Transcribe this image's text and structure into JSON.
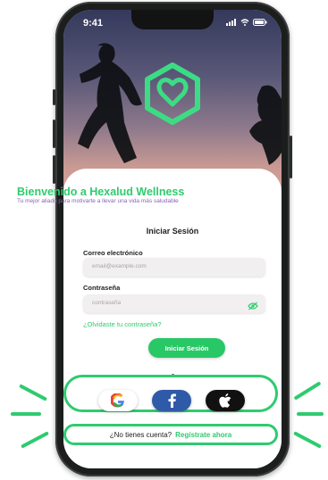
{
  "status_bar": {
    "time": "9:41"
  },
  "login": {
    "title": "Bienvenido a Hexalud Wellness",
    "subtitle": "Tu mejor aliado para motivarte a llevar una vida más saludable",
    "section_title": "Iniciar Sesión",
    "email_label": "Correo electrónico",
    "email_placeholder": "email@example.com",
    "password_label": "Contraseña",
    "password_placeholder": "contraseña",
    "forgot_password": "¿Olvidaste tu contraseña?",
    "submit_label": "Iniciar Sesión"
  },
  "social": {
    "items": [
      {
        "icon": "google-icon"
      },
      {
        "icon": "facebook-icon"
      },
      {
        "icon": "apple-icon"
      }
    ]
  },
  "signup": {
    "prompt": "¿No tienes cuenta?",
    "link": "Regístrate ahora"
  },
  "colors": {
    "accent": "#2ecb6f",
    "subtitle": "#8a63b9",
    "facebook": "#2f5aa8",
    "apple_bg": "#111111"
  }
}
